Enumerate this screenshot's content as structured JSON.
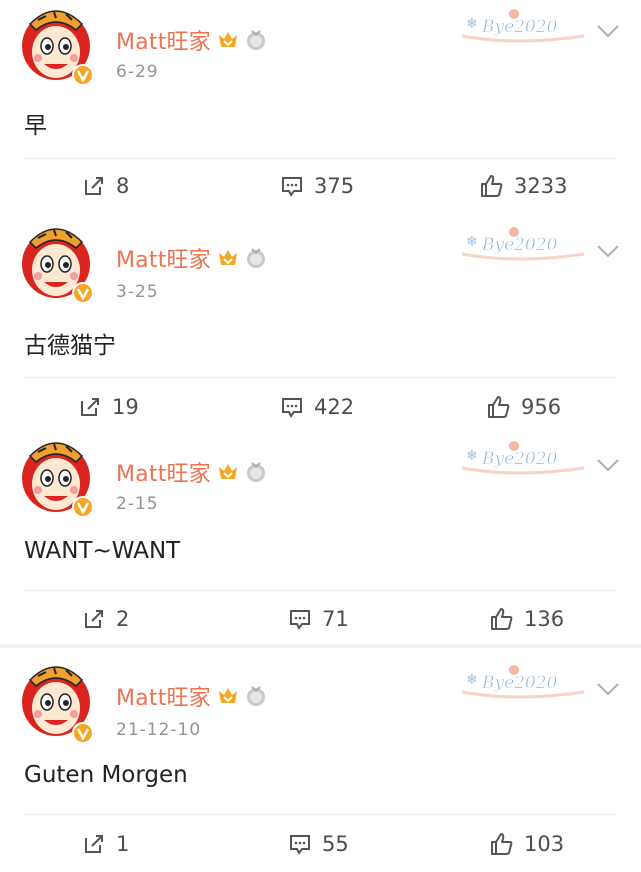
{
  "colors": {
    "name": "#eb7350",
    "date": "#939393",
    "icon": "#555555",
    "accent_badge": "#f5a623"
  },
  "icons": {
    "avatar": "cartoon-mascot-avatar",
    "verified": "verified-v-icon",
    "member_badge": "vip-crown-badge-icon",
    "medal_badge": "silver-medal-icon",
    "decoration": "bye2020-card-decoration",
    "more": "chevron-down-icon",
    "repost": "repost-icon",
    "comment": "comment-icon",
    "like": "like-icon"
  },
  "decoration_text": "Bye2020",
  "posts": [
    {
      "author": "Matt旺家",
      "date": "6-29",
      "text": "早",
      "reposts": "8",
      "comments": "375",
      "likes": "3233"
    },
    {
      "author": "Matt旺家",
      "date": "3-25",
      "text": "古德猫宁",
      "reposts": "19",
      "comments": "422",
      "likes": "956"
    },
    {
      "author": "Matt旺家",
      "date": "2-15",
      "text": "WANT~WANT",
      "reposts": "2",
      "comments": "71",
      "likes": "136"
    },
    {
      "author": "Matt旺家",
      "date": "21-12-10",
      "text": "Guten Morgen",
      "reposts": "1",
      "comments": "55",
      "likes": "103"
    }
  ]
}
